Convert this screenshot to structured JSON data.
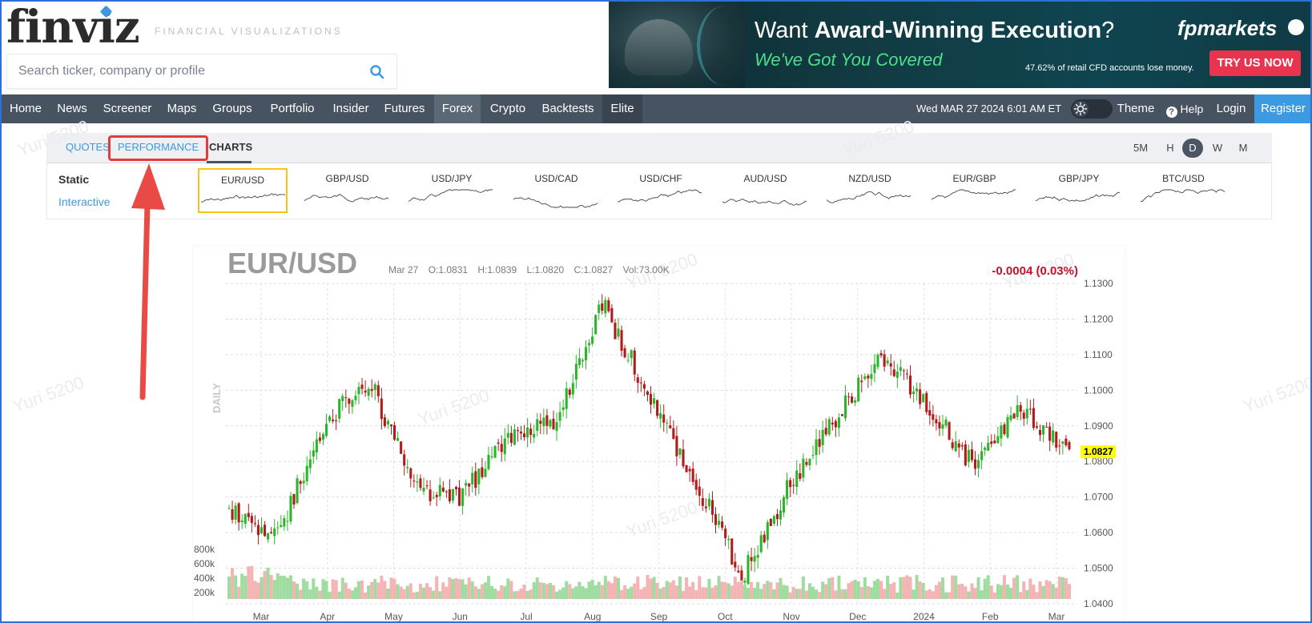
{
  "header": {
    "logo_text": "finviz",
    "tagline": "FINANCIAL VISUALIZATIONS",
    "search_placeholder": "Search ticker, company or profile"
  },
  "ad": {
    "title_prefix": "Want ",
    "title_bold": "Award-Winning Execution",
    "title_suffix": "?",
    "subtitle": "We've Got You Covered",
    "brand": "fpmarkets",
    "disclaimer": "47.62% of retail CFD accounts lose money.",
    "cta": "TRY US NOW"
  },
  "nav": {
    "items": [
      "Home",
      "News",
      "Screener",
      "Maps",
      "Groups",
      "Portfolio",
      "Insider",
      "Futures",
      "Forex",
      "Crypto",
      "Backtests",
      "Elite"
    ],
    "active": "Forex",
    "datetime": "Wed MAR 27 2024 6:01 AM ET",
    "theme_label": "Theme",
    "help_label": "Help",
    "login_label": "Login",
    "register_label": "Register"
  },
  "tabs": {
    "items": [
      "QUOTES",
      "PERFORMANCE",
      "CHARTS"
    ],
    "active": "CHARTS",
    "highlighted": "PERFORMANCE",
    "timeframes": [
      "5M",
      "H",
      "D",
      "W",
      "M"
    ],
    "selected_timeframe": "D"
  },
  "mini_charts": {
    "static_label": "Static",
    "interactive_label": "Interactive",
    "pairs": [
      "EUR/USD",
      "GBP/USD",
      "USD/JPY",
      "USD/CAD",
      "USD/CHF",
      "AUD/USD",
      "NZD/USD",
      "EUR/GBP",
      "GBP/JPY",
      "BTC/USD"
    ],
    "selected": "EUR/USD"
  },
  "chart": {
    "symbol": "EUR/USD",
    "date": "Mar 27",
    "open": "O:1.0831",
    "high": "H:1.0839",
    "low": "L:1.0820",
    "close": "C:1.0827",
    "volume": "Vol:73.00K",
    "change": "-0.0004 (0.03%)",
    "period_label": "DAILY",
    "last_price": "1.0827",
    "colors": {
      "up": "#2bb52b",
      "down": "#b01b1b",
      "vol_up": "#9fdc9f",
      "vol_down": "#f4b4b4",
      "last_price_bg": "#ffff00"
    }
  },
  "chart_data": {
    "type": "candlestick",
    "title": "EUR/USD",
    "xlabel": "",
    "ylabel": "",
    "ylim": [
      1.04,
      1.13
    ],
    "y_ticks": [
      "1.1300",
      "1.1200",
      "1.1100",
      "1.1000",
      "1.0900",
      "1.0800",
      "1.0700",
      "1.0600",
      "1.0500",
      "1.0400"
    ],
    "volume_ticks": [
      "800k",
      "600k",
      "400k",
      "200k"
    ],
    "x_ticks": [
      "Mar",
      "Apr",
      "May",
      "Jun",
      "Jul",
      "Aug",
      "Sep",
      "Oct",
      "Nov",
      "Dec",
      "2024",
      "Feb",
      "Mar"
    ],
    "approx_close_path": [
      {
        "x": "Mar 2023",
        "y": 1.066
      },
      {
        "x": "Mar 2023 mid",
        "y": 1.058
      },
      {
        "x": "Apr 2023",
        "y": 1.09
      },
      {
        "x": "May 2023",
        "y": 1.103
      },
      {
        "x": "May 2023 end",
        "y": 1.072
      },
      {
        "x": "Jun 2023",
        "y": 1.07
      },
      {
        "x": "Jun 2023 end",
        "y": 1.088
      },
      {
        "x": "Jul 2023",
        "y": 1.091
      },
      {
        "x": "Jul 2023 mid",
        "y": 1.124
      },
      {
        "x": "Aug 2023",
        "y": 1.099
      },
      {
        "x": "Sep 2023",
        "y": 1.074
      },
      {
        "x": "Oct 2023",
        "y": 1.048
      },
      {
        "x": "Nov 2023",
        "y": 1.073
      },
      {
        "x": "Dec 2023",
        "y": 1.092
      },
      {
        "x": "Dec 2023 end",
        "y": 1.11
      },
      {
        "x": "2024",
        "y": 1.095
      },
      {
        "x": "Feb 2024",
        "y": 1.078
      },
      {
        "x": "Mar 2024",
        "y": 1.095
      },
      {
        "x": "Mar 27 2024",
        "y": 1.0827
      }
    ]
  }
}
